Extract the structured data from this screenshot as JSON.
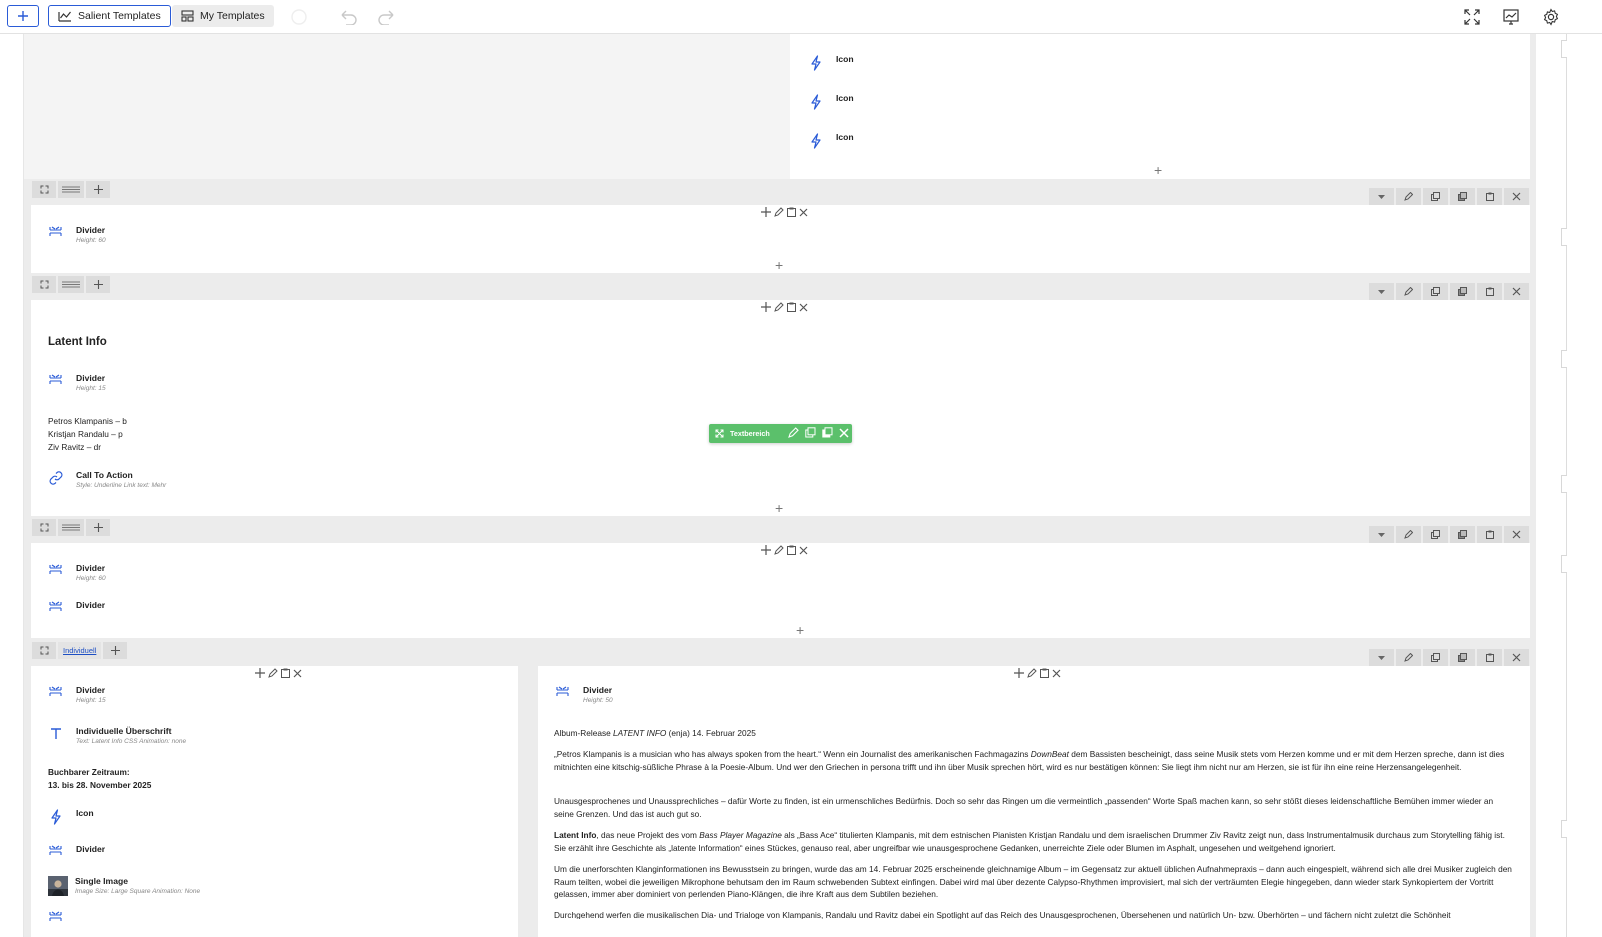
{
  "toolbar": {
    "salient_templates": "Salient Templates",
    "my_templates": "My Templates"
  },
  "elements": {
    "icon": "Icon",
    "divider": "Divider",
    "call_to_action": "Call To Action",
    "single_image": "Single Image",
    "custom_heading": "Individuelle Überschrift"
  },
  "sub": {
    "height_60": "Height: 60",
    "height_15": "Height: 15",
    "height_50": "Height: 50",
    "cta_style": "Style: Underline  Link text: Mehr",
    "heading_meta": "Text: Latent Info  CSS Animation: none",
    "image_meta": "Image Size: Large Square  Animation: None"
  },
  "section_latent": {
    "heading": "Latent Info",
    "members": [
      "Petros Klampanis – b",
      "Kristjan Randalu – p",
      "Ziv Ravitz – dr"
    ]
  },
  "textbereich_label": "Textbereich",
  "row_label_individuell": "Individuell",
  "left_column": {
    "bookable_label": "Buchbarer Zeitraum:",
    "bookable_dates": "13. bis 28. November 2025"
  },
  "article": {
    "release_a": "Album-Release ",
    "release_em": "LATENT INFO",
    "release_b": " (enja) 14. Februar 2025",
    "p1a": "„Petros Klampanis is a musician who has always spoken from the heart.“ Wenn ein Journalist des amerikanischen Fachmagazins ",
    "p1em": "DownBeat",
    "p1b": " dem Bassisten bescheinigt, dass seine Musik stets vom Herzen komme und er mit dem Herzen spreche, dann ist dies mitnichten eine kitschig-süßliche Phrase à la Poesie-Album. Und wer den Griechen in persona trifft und ihn über Musik sprechen hört, wird es nur bestätigen können: Sie liegt ihm nicht nur am Herzen, sie ist für ihn eine reine Herzensangelegenheit.",
    "p2": "Unausgesprochenes und Unaussprechliches – dafür Worte zu finden, ist ein urmenschliches Bedürfnis. Doch so sehr das Ringen um die vermeintlich „passenden“ Worte Spaß machen kann, so sehr stößt dieses leidenschaftliche Bemühen immer wieder an seine Grenzen. Und das ist auch gut so.",
    "p3strong": "Latent Info",
    "p3a": ", das neue Projekt des vom ",
    "p3em": "Bass Player Magazine",
    "p3b": " als „Bass Ace“ titulierten Klampanis, mit dem estnischen Pianisten Kristjan Randalu und dem israelischen Drummer Ziv Ravitz zeigt nun, dass Instrumentalmusik durchaus zum Storytelling fähig ist. Sie erzählt ihre Geschichte als „latente Information“ eines Stückes, genauso real, aber ungreifbar wie unausgesprochene Gedanken, unerreichte Ziele oder Blumen im Asphalt, ungesehen und weitgehend ignoriert.",
    "p4": "Um die unerforschten Klanginformationen ins Bewusstsein zu bringen, wurde das am 14. Februar 2025 erscheinende gleichnamige Album – im Gegensatz zur aktuell üblichen Aufnahmepraxis – dann auch eingespielt, während sich alle drei Musiker zugleich den Raum teilten, wobei die jeweiligen Mikrophone behutsam den im Raum schwebenden Subtext einfingen. Dabei wird mal über dezente Calypso-Rhythmen improvisiert, mal sich der verträumten Elegie hingegeben, dann wieder stark Synkopiertem der Vortritt gelassen, immer aber dominiert von perlenden Piano-Klängen, die ihre Kraft aus dem Subtilen beziehen.",
    "p5": "Durchgehend werfen die musikalischen Dia- und Trialoge von Klampanis, Randalu und Ravitz dabei ein Spotlight auf das Reich des Unausgesprochenen, Übersehenen und natürlich Un- bzw. Überhörten – und fächern nicht zuletzt die Schönheit"
  },
  "colors": {
    "accent": "#2a5bd7",
    "textbereich": "#5bc06b"
  }
}
